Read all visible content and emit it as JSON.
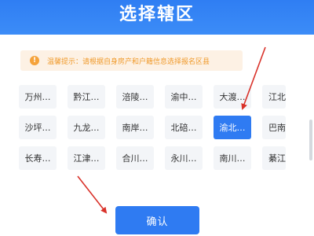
{
  "header": {
    "title": "选择辖区"
  },
  "tip": {
    "icon": "warning-icon",
    "icon_glyph": "!",
    "text": "温馨提示：请根据自身房产和户籍信息选择报名区县"
  },
  "districts": [
    [
      "万州…",
      "黔江…",
      "涪陵…",
      "渝中…",
      "大渡…",
      "江北…"
    ],
    [
      "沙坪…",
      "九龙…",
      "南岸…",
      "北碚…",
      "渝北…",
      "巴南…"
    ],
    [
      "长寿…",
      "江津…",
      "合川…",
      "永川…",
      "南川…",
      "綦江…"
    ]
  ],
  "selected_district": "渝北…",
  "confirm_label": "确认",
  "colors": {
    "primary": "#2f7bf2",
    "tip_background": "#fdf1e4",
    "tip_text": "#f09a2c",
    "annotation_arrow": "#d9322a"
  }
}
